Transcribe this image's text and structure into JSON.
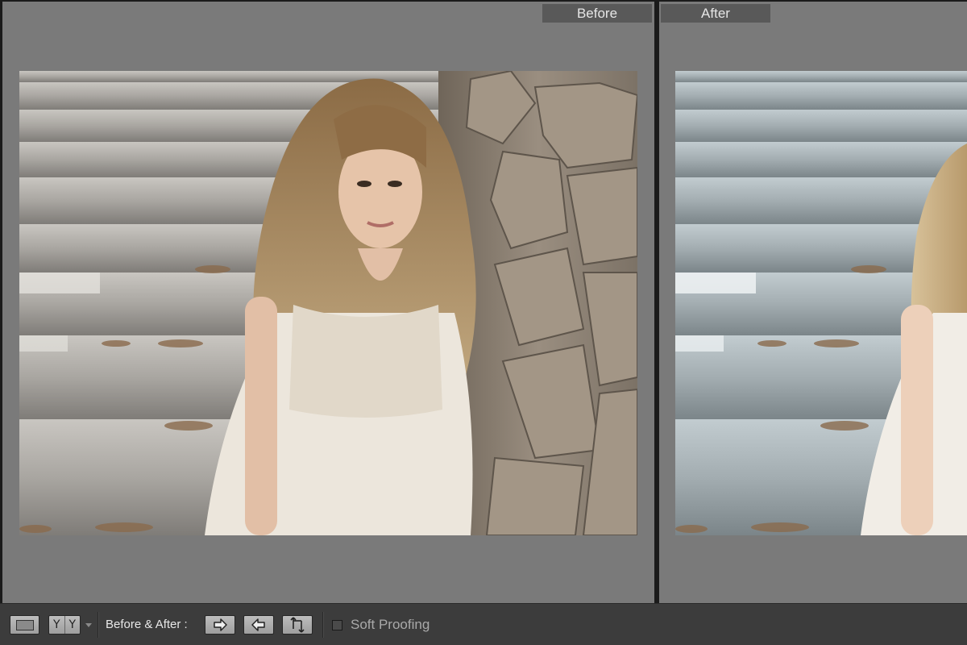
{
  "panes": {
    "before_label": "Before",
    "after_label": "After"
  },
  "toolbar": {
    "loupe_icon": "single-view-icon",
    "compare_icon": "before-after-yy-icon",
    "yy_left": "Y",
    "yy_right": "Y",
    "before_after_label": "Before & After :",
    "copy_before_to_after_icon": "copy-right-arrow-icon",
    "copy_after_to_before_icon": "copy-left-arrow-icon",
    "swap_icon": "swap-before-after-icon",
    "soft_proofing_label": "Soft Proofing",
    "soft_proofing_checked": "false"
  },
  "colors": {
    "pane_background": "#7a7a7a",
    "label_background": "#595959",
    "toolbar_background": "#3c3c3c"
  }
}
